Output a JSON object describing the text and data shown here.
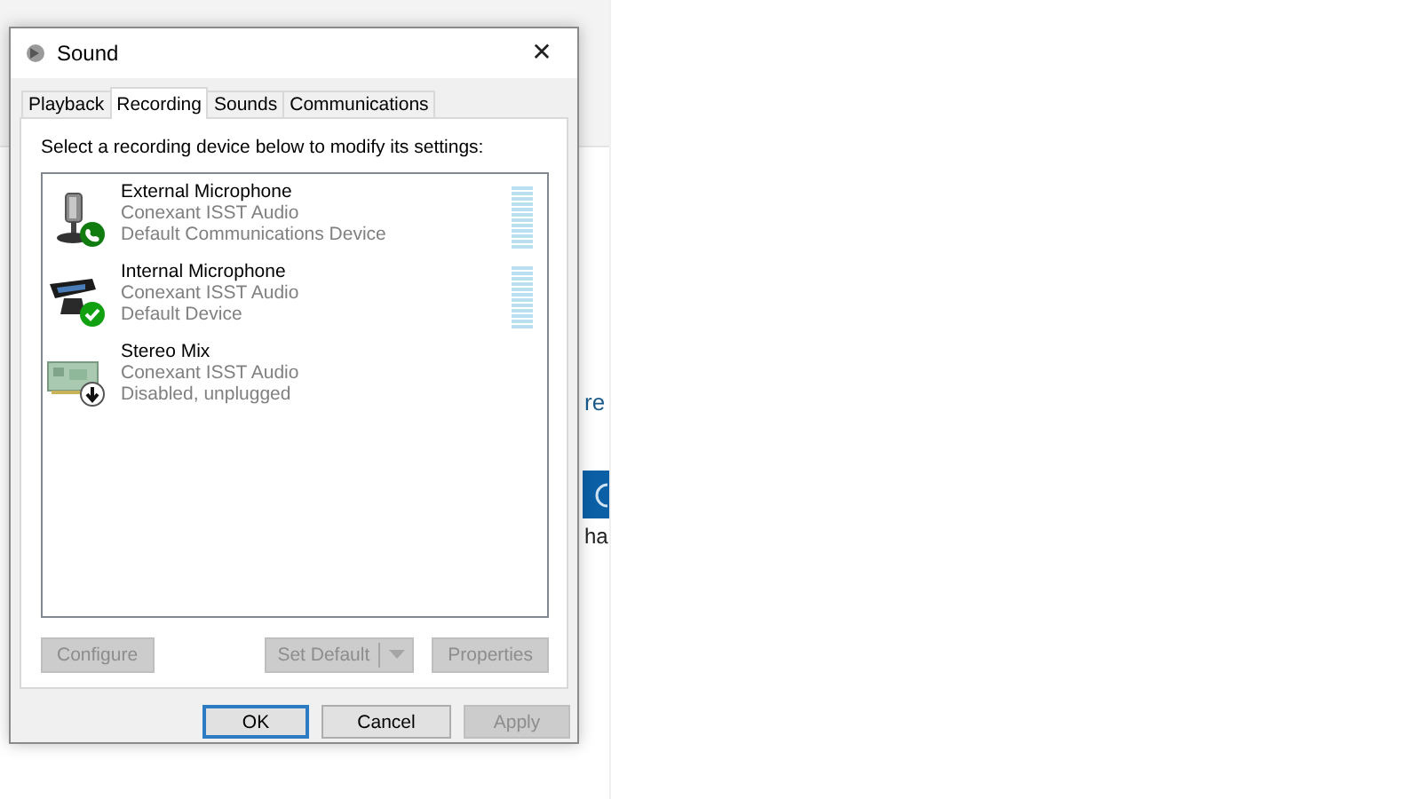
{
  "background": {
    "link": "re",
    "caption": "ha"
  },
  "window": {
    "title": "Sound",
    "close": "✕"
  },
  "tabs": [
    {
      "label": "Playback",
      "selected": false
    },
    {
      "label": "Recording",
      "selected": true
    },
    {
      "label": "Sounds",
      "selected": false
    },
    {
      "label": "Communications",
      "selected": false
    }
  ],
  "instruction": "Select a recording device below to modify its settings:",
  "devices": [
    {
      "name": "External Microphone",
      "driver": "Conexant ISST Audio",
      "status": "Default Communications Device",
      "kind": "microphone",
      "badge": {
        "kind": "phone"
      },
      "meter": true
    },
    {
      "name": "Internal Microphone",
      "driver": "Conexant ISST Audio",
      "status": "Default Device",
      "kind": "webcam",
      "badge": {
        "kind": "check"
      },
      "meter": true
    },
    {
      "name": "Stereo Mix",
      "driver": "Conexant ISST Audio",
      "status": "Disabled, unplugged",
      "kind": "card",
      "badge": {
        "kind": "down"
      },
      "meter": false
    }
  ],
  "panel_buttons": [
    {
      "label": "Configure",
      "disabled": true,
      "kind": "plain"
    },
    {
      "label": "Set Default",
      "disabled": true,
      "kind": "split"
    },
    {
      "label": "Properties",
      "disabled": true,
      "kind": "plain"
    }
  ],
  "dialog_buttons": [
    {
      "label": "OK",
      "disabled": false,
      "default": true
    },
    {
      "label": "Cancel",
      "disabled": false,
      "default": false
    },
    {
      "label": "Apply",
      "disabled": true,
      "default": false
    }
  ]
}
